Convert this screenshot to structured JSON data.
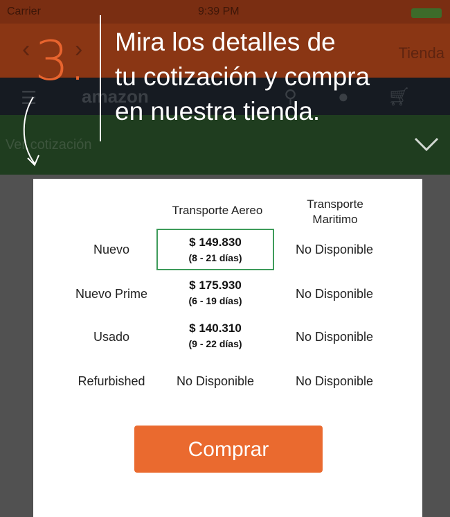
{
  "status": {
    "carrier": "Carrier",
    "time": "9:39 PM"
  },
  "nav": {
    "back_glyph": "‹",
    "forward_glyph": "›",
    "store_label": "Tienda"
  },
  "amazon": {
    "logo": "amazon",
    "menu_icon": "menu-icon",
    "search_icon": "search-icon",
    "account_icon": "account-icon",
    "cart_icon": "cart-icon"
  },
  "quote_bar": {
    "label": "Ver cotización"
  },
  "overlay": {
    "step_number": "3.",
    "headline_lines": [
      "Mira los detalles de",
      "tu cotización y compra",
      "en nuestra tienda."
    ]
  },
  "table": {
    "headers": {
      "air": "Transporte Aereo",
      "sea_line1": "Transporte",
      "sea_line2": "Maritimo"
    },
    "rows": [
      {
        "label": "Nuevo",
        "air_price": "$ 149.830",
        "air_days": "(8 - 21 días)",
        "sea": "No Disponible"
      },
      {
        "label": "Nuevo Prime",
        "air_price": "$ 175.930",
        "air_days": "(6 - 19 días)",
        "sea": "No Disponible"
      },
      {
        "label": "Usado",
        "air_price": "$ 140.310",
        "air_days": "(9 - 22 días)",
        "sea": "No Disponible"
      },
      {
        "label": "Refurbished",
        "air_text": "No Disponible",
        "sea": "No Disponible"
      }
    ]
  },
  "buy_button": {
    "label": "Comprar",
    "color": "#ea6a2f"
  },
  "colors": {
    "accent_orange": "#e8642e",
    "highlight_green": "#3e9b5a"
  }
}
